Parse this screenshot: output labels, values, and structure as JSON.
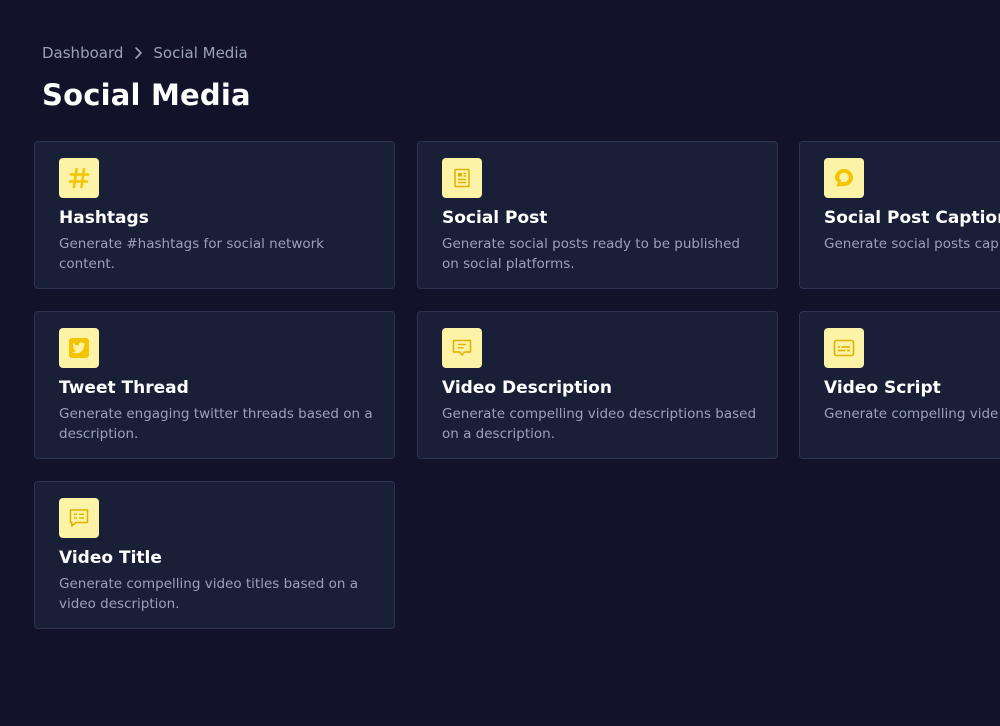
{
  "breadcrumb": {
    "items": [
      "Dashboard",
      "Social Media"
    ]
  },
  "page": {
    "title": "Social Media"
  },
  "cards": [
    {
      "title": "Hashtags",
      "description": "Generate #hashtags for social network content.",
      "icon": "hashtag-icon"
    },
    {
      "title": "Social Post",
      "description": "Generate social posts ready to be published on social platforms.",
      "icon": "document-icon"
    },
    {
      "title": "Social Post Caption",
      "description": "Generate social posts cap attention.",
      "icon": "chat-bubble-icon"
    },
    {
      "title": "Tweet Thread",
      "description": "Generate engaging twitter threads based on a description.",
      "icon": "twitter-icon"
    },
    {
      "title": "Video Description",
      "description": "Generate compelling video descriptions based on a description.",
      "icon": "message-icon"
    },
    {
      "title": "Video Script",
      "description": "Generate compelling vide a description.",
      "icon": "subtitles-icon"
    },
    {
      "title": "Video Title",
      "description": "Generate compelling video titles based on a video description.",
      "icon": "text-message-icon"
    }
  ],
  "colors": {
    "background": "#12132a",
    "card_background": "#1a1f38",
    "card_border": "#2d3350",
    "icon_background": "#fdf3a6",
    "icon_accent": "#f5c400",
    "muted_text": "#9aa1b8",
    "title_text": "#ffffff"
  }
}
